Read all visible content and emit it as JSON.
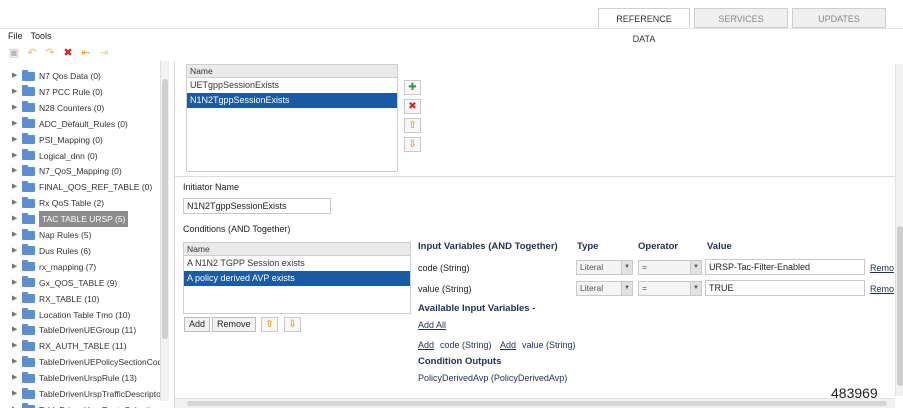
{
  "tabs": {
    "reference": "REFERENCE DATA",
    "services": "SERVICES",
    "updates": "UPDATES"
  },
  "menu": {
    "file": "File",
    "tools": "Tools"
  },
  "tree": [
    {
      "label": "N7 Qos Data (0)"
    },
    {
      "label": "N7 PCC Rule (0)"
    },
    {
      "label": "N28 Counters (0)"
    },
    {
      "label": "ADC_Default_Rules (0)"
    },
    {
      "label": "PSI_Mapping (0)"
    },
    {
      "label": "Logical_dnn (0)"
    },
    {
      "label": "N7_QoS_Mapping (0)"
    },
    {
      "label": "FINAL_QOS_REF_TABLE (0)"
    },
    {
      "label": "Rx QoS Table (2)"
    },
    {
      "label": "TAC TABLE URSP (5)",
      "selected": true
    },
    {
      "label": "Nap Rules (5)"
    },
    {
      "label": "Dus Rules (6)"
    },
    {
      "label": "rx_mapping (7)"
    },
    {
      "label": "Gx_QOS_TABLE (9)"
    },
    {
      "label": "RX_TABLE (10)"
    },
    {
      "label": "Location Table Tmo (10)"
    },
    {
      "label": "TableDrivenUEGroup (11)"
    },
    {
      "label": "RX_AUTH_TABLE (11)"
    },
    {
      "label": "TableDrivenUEPolicySectionCode"
    },
    {
      "label": "TableDrivenUrspRule (13)"
    },
    {
      "label": "TableDrivenUrspTrafficDescripto"
    },
    {
      "label": "TableDrivenUrspRouteSelection"
    }
  ],
  "rules_list": {
    "header": "Name",
    "rows": [
      "UETgppSessionExists",
      "N1N2TgppSessionExists"
    ]
  },
  "initiator": {
    "label": "Initiator Name",
    "value": "N1N2TgppSessionExists"
  },
  "conditions": {
    "label": "Conditions (AND Together)",
    "header": "Name",
    "rows": [
      "A N1N2 TGPP Session exists",
      "A policy derived AVP exists"
    ],
    "add": "Add",
    "remove": "Remove"
  },
  "inputs": {
    "headers": {
      "vars": "Input Variables (AND Together)",
      "type": "Type",
      "operator": "Operator",
      "value": "Value"
    },
    "rows": [
      {
        "name": "code (String)",
        "type": "Literal",
        "operator": "=",
        "value": "URSP-Tac-Filter-Enabled",
        "remove": "Remo"
      },
      {
        "name": "value (String)",
        "type": "Literal",
        "operator": "=",
        "value": "TRUE",
        "remove": "Remo"
      }
    ],
    "available": "Available Input Variables -",
    "add_all": "Add All",
    "add1": "Add",
    "add1_text": "code (String)",
    "add2": "Add",
    "add2_text": "value (String)",
    "outputs": "Condition Outputs",
    "output_value": "PolicyDerivedAvp (PolicyDerivedAvp)"
  },
  "ref_number": "483969"
}
